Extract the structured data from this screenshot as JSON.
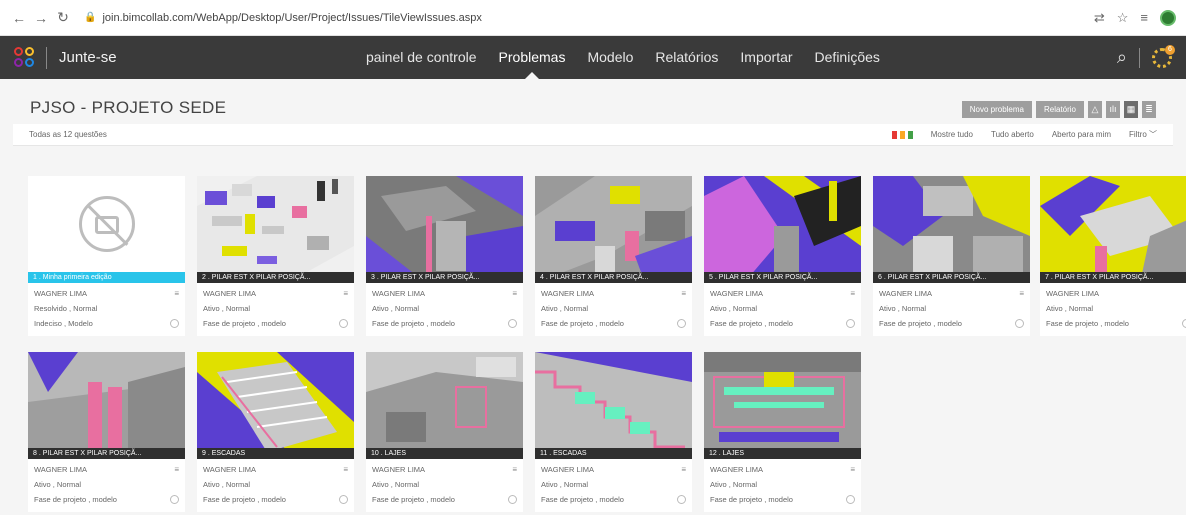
{
  "browser": {
    "url": "join.bimcollab.com/WebApp/Desktop/User/Project/Issues/TileViewIssues.aspx"
  },
  "header": {
    "app_name": "Junte-se",
    "nav": [
      "painel de controle",
      "Problemas",
      "Modelo",
      "Relatórios",
      "Importar",
      "Definições"
    ],
    "active_nav": "Problemas",
    "gear_badge": "6"
  },
  "page": {
    "title": "PJSO - PROJETO SEDE",
    "new_issue_button": "Novo problema",
    "report_button": "Relatório",
    "filter_summary": "Todas as 12 questões",
    "show_all": "Mostre tudo",
    "all_open": "Tudo aberto",
    "open_for_me": "Aberto para mim",
    "filter": "Filtro"
  },
  "colors": {
    "header_bg": "#3a3a3a",
    "highlight_label": "#29c4ea",
    "flag_red": "#e53935",
    "flag_orange": "#f9a825",
    "flag_green": "#43a047"
  },
  "cards": [
    {
      "title": "1 . Minha primeira edição",
      "author": "WAGNER LIMA",
      "status": "Resolvido , Normal",
      "phase": "Indeciso , Modelo"
    },
    {
      "title": "2 . PILAR EST X PILAR POSIÇÃ...",
      "author": "WAGNER LIMA",
      "status": "Ativo , Normal",
      "phase": "Fase de projeto , modelo"
    },
    {
      "title": "3 . PILAR EST X PILAR POSIÇÃ...",
      "author": "WAGNER LIMA",
      "status": "Ativo , Normal",
      "phase": "Fase de projeto , modelo"
    },
    {
      "title": "4 . PILAR EST X PILAR POSIÇÃ...",
      "author": "WAGNER LIMA",
      "status": "Ativo , Normal",
      "phase": "Fase de projeto , modelo"
    },
    {
      "title": "5 . PILAR EST X PILAR POSIÇÃ...",
      "author": "WAGNER LIMA",
      "status": "Ativo , Normal",
      "phase": "Fase de projeto , modelo"
    },
    {
      "title": "6 . PILAR EST X PILAR POSIÇÃ...",
      "author": "WAGNER LIMA",
      "status": "Ativo , Normal",
      "phase": "Fase de projeto , modelo"
    },
    {
      "title": "7 . PILAR EST X PILAR POSIÇÃ...",
      "author": "WAGNER LIMA",
      "status": "Ativo , Normal",
      "phase": "Fase de projeto , modelo"
    },
    {
      "title": "8 . PILAR EST X PILAR POSIÇÃ...",
      "author": "WAGNER LIMA",
      "status": "Ativo , Normal",
      "phase": "Fase de projeto , modelo"
    },
    {
      "title": "9 . ESCADAS",
      "author": "WAGNER LIMA",
      "status": "Ativo , Normal",
      "phase": "Fase de projeto , modelo"
    },
    {
      "title": "10 . LAJES",
      "author": "WAGNER LIMA",
      "status": "Ativo , Normal",
      "phase": "Fase de projeto , modelo"
    },
    {
      "title": "11 . ESCADAS",
      "author": "WAGNER LIMA",
      "status": "Ativo , Normal",
      "phase": "Fase de projeto , modelo"
    },
    {
      "title": "12 . LAJES",
      "author": "WAGNER LIMA",
      "status": "Ativo , Normal",
      "phase": "Fase de projeto , modelo"
    }
  ]
}
